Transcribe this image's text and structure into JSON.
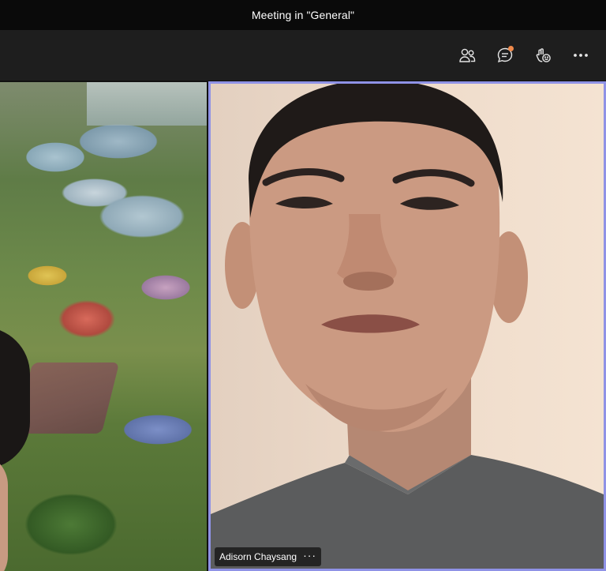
{
  "window": {
    "title": "Meeting in \"General\""
  },
  "toolbar": {
    "items": [
      {
        "icon": "people-icon",
        "label": "Participants"
      },
      {
        "icon": "chat-icon",
        "label": "Chat",
        "has_notification": true
      },
      {
        "icon": "reactions-icon",
        "label": "Reactions"
      },
      {
        "icon": "more-options-icon",
        "label": "More actions"
      }
    ],
    "notification_color": "#f08a4b"
  },
  "participants": [
    {
      "position": "left",
      "name": ""
    },
    {
      "position": "right",
      "name": "Adisorn Chaysang",
      "more_label": "···",
      "active_speaker": true,
      "highlight_color": "#8f92e6"
    }
  ]
}
